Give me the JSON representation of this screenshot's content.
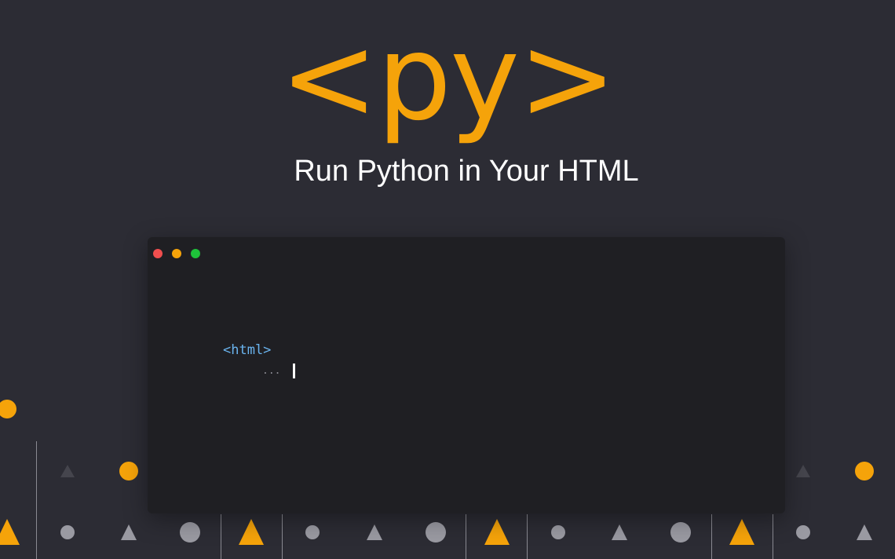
{
  "hero": {
    "logo_text": "<py>",
    "tagline": "Run Python in Your HTML"
  },
  "terminal": {
    "window_controls": [
      "close",
      "minimize",
      "maximize"
    ],
    "line1": "<html>",
    "line2": "..."
  },
  "colors": {
    "background": "#2c2c34",
    "accent": "#f5a30a",
    "terminal_bg": "#1f1f23",
    "code_tag": "#6ab4ef",
    "close_dot": "#f04e4e",
    "minimize_dot": "#f5a30a",
    "maximize_dot": "#1ec23a"
  }
}
